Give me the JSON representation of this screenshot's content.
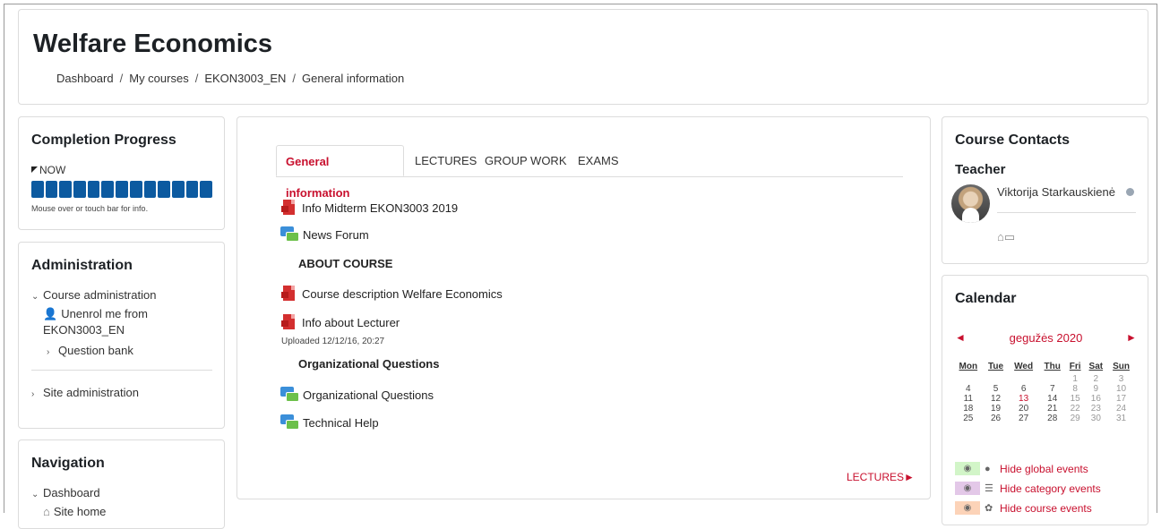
{
  "header": {
    "title": "Welfare Economics",
    "breadcrumb": [
      "Dashboard",
      "My courses",
      "EKON3003_EN",
      "General information"
    ],
    "separator": "/"
  },
  "completion": {
    "title": "Completion Progress",
    "now_label": "NOW",
    "hint": "Mouse over or touch bar for info.",
    "segments": 13,
    "bar_color": "#0c5aa0"
  },
  "administration": {
    "title": "Administration",
    "course_admin": "Course administration",
    "unenrol_line1": "Unenrol me from",
    "unenrol_line2": "EKON3003_EN",
    "question_bank": "Question bank",
    "site_admin": "Site administration"
  },
  "navigation": {
    "title": "Navigation",
    "dashboard": "Dashboard",
    "site_home": "Site home"
  },
  "main": {
    "tabs": [
      "General information",
      "LECTURES",
      "GROUP WORK",
      "EXAMS"
    ],
    "active_tab": "General information",
    "activities": {
      "info_midterm": "Info Midterm EKON3003 2019",
      "news_forum": "News Forum",
      "about_course": "ABOUT COURSE",
      "course_description": "Course description Welfare Economics",
      "info_lecturer": "Info about Lecturer",
      "uploaded": "Uploaded 12/12/16, 20:27",
      "org_questions_heading": "Organizational Questions",
      "org_questions": "Organizational Questions",
      "technical_help": "Technical Help"
    },
    "next_link": "LECTURES►",
    "accent": "#c8102e"
  },
  "contacts": {
    "title": "Course Contacts",
    "role": "Teacher",
    "teacher_name": "Viktorija Starkauskienė",
    "message_icons": "⌂▭"
  },
  "calendar": {
    "title": "Calendar",
    "month": "gegužės 2020",
    "prev": "◄",
    "next": "►",
    "weekdays": [
      "Mon",
      "Tue",
      "Wed",
      "Thu",
      "Fri",
      "Sat",
      "Sun"
    ],
    "weeks": [
      [
        "",
        "",
        "",
        "",
        "1",
        "2",
        "3"
      ],
      [
        "4",
        "5",
        "6",
        "7",
        "8",
        "9",
        "10"
      ],
      [
        "11",
        "12",
        "13",
        "14",
        "15",
        "16",
        "17"
      ],
      [
        "18",
        "19",
        "20",
        "21",
        "22",
        "23",
        "24"
      ],
      [
        "25",
        "26",
        "27",
        "28",
        "29",
        "30",
        "31"
      ]
    ],
    "today": "13",
    "events": {
      "global": "Hide global events",
      "category": "Hide category events",
      "course": "Hide course events"
    },
    "event_colors": {
      "global": "#d2f5c8",
      "category": "#e3c8e8",
      "course": "#fcd3b8"
    }
  }
}
